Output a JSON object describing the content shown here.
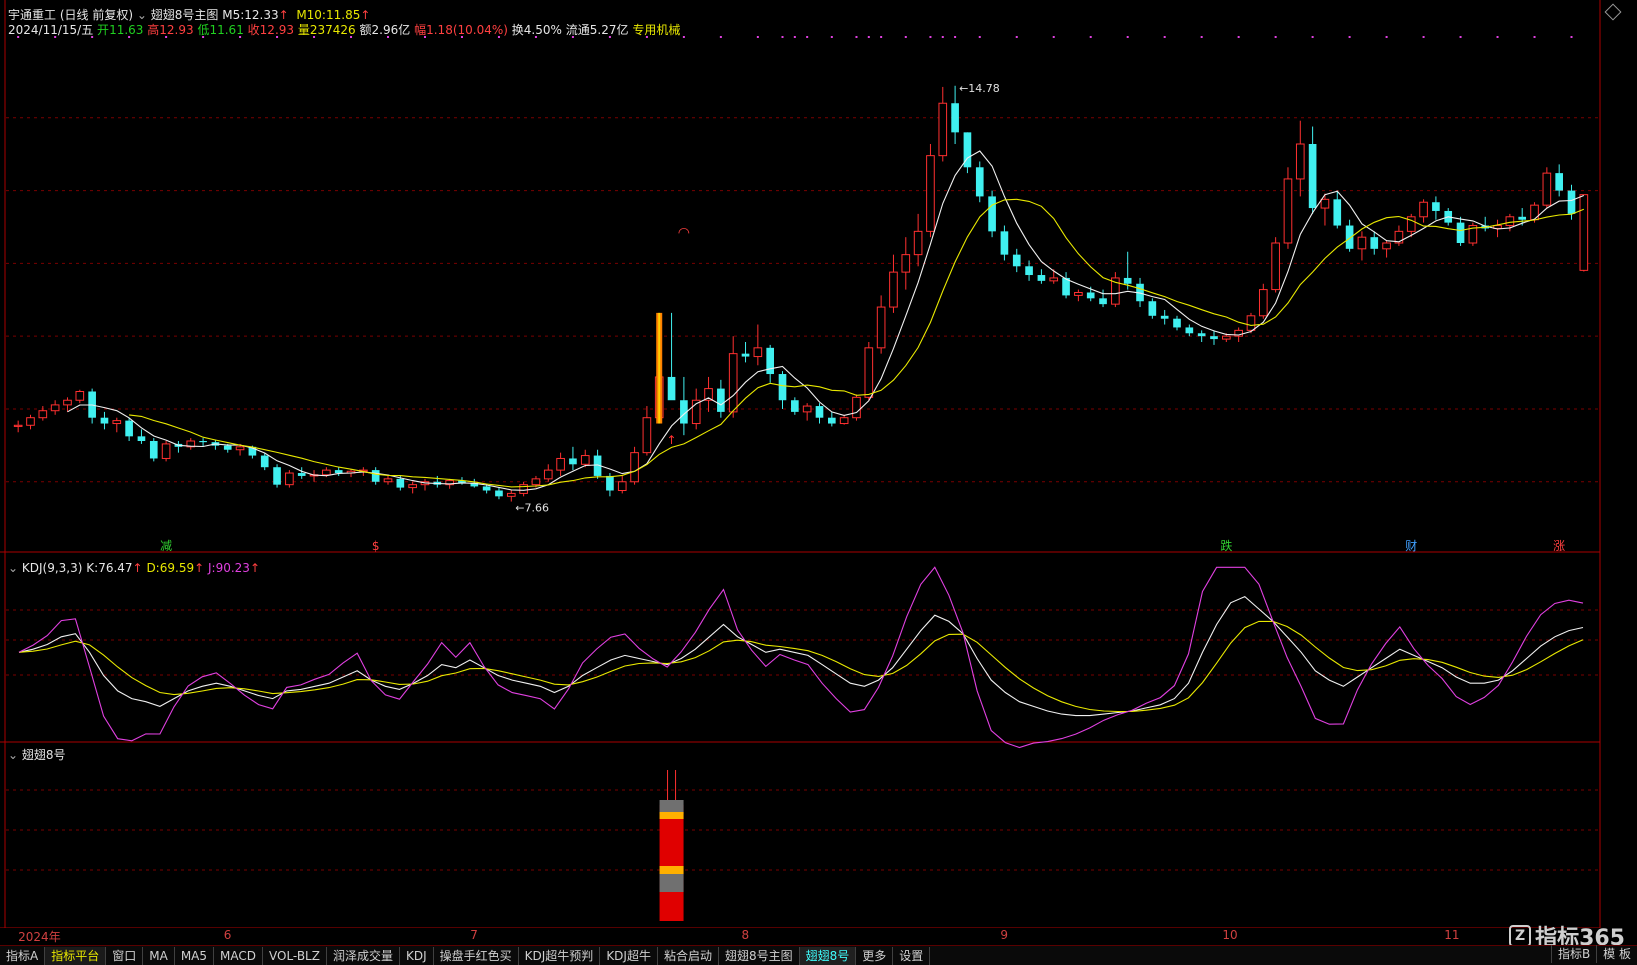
{
  "header": {
    "stock_name": "宇通重工",
    "period": "(日线 前复权)",
    "indicator": "翅翅8号主图",
    "ma5_label": "M5:",
    "ma5_value": "12.33",
    "ma10_label": "M10:",
    "ma10_value": "11.85",
    "date": "2024/11/15/五",
    "open_label": "开",
    "open": "11.63",
    "high_label": "高",
    "high": "12.93",
    "low_label": "低",
    "low": "11.61",
    "close_label": "收",
    "close": "12.93",
    "vol_label": "量",
    "vol": "237426",
    "amount_label": "额",
    "amount": "2.96亿",
    "change_label": "幅",
    "change": "1.18(10.04%)",
    "turnover_label": "换",
    "turnover": "4.50%",
    "float_label": "流通",
    "float": "5.27亿",
    "sector": "专用机械"
  },
  "kdj": {
    "title": "KDJ(9,3,3)",
    "k_label": "K:",
    "k": "76.47",
    "d_label": "D:",
    "d": "69.59",
    "j_label": "J:",
    "j": "90.23"
  },
  "sub2": {
    "title": "翅翅8号"
  },
  "time_axis": [
    {
      "label": "2024年",
      "i": 0
    },
    {
      "label": "6",
      "i": 17
    },
    {
      "label": "7",
      "i": 37
    },
    {
      "label": "8",
      "i": 59
    },
    {
      "label": "9",
      "i": 80
    },
    {
      "label": "10",
      "i": 98
    },
    {
      "label": "11",
      "i": 116
    }
  ],
  "markers": [
    {
      "label": "减",
      "i": 12,
      "color": "#30d030"
    },
    {
      "label": "$",
      "i": 29,
      "color": "#ff4040"
    },
    {
      "label": "跌",
      "i": 98,
      "color": "#30d030"
    },
    {
      "label": "财",
      "i": 113,
      "color": "#40a0ff"
    },
    {
      "label": "涨",
      "i": 125,
      "color": "#ff4040"
    }
  ],
  "annotations": {
    "high_label": "14.78",
    "low_label": "7.66"
  },
  "tabs": [
    "指标A",
    "指标平台",
    "窗口",
    "MA",
    "MA5",
    "MACD",
    "VOL-BLZ",
    "润泽成交量",
    "KDJ",
    "操盘手红色买",
    "KDJ超牛预判",
    "KDJ超牛",
    "粘合启动",
    "翅翅8号主图",
    "翅翅8号",
    "更多",
    "设置"
  ],
  "right_tabs": [
    "指标B",
    "模 板"
  ],
  "brand": "指标365",
  "colors": {
    "up": "#ff3030",
    "down": "#40f0f0",
    "ma5": "#f0f0f0",
    "ma10": "#e8e800",
    "k": "#f0f0f0",
    "d": "#e8e800",
    "j": "#e040e0",
    "grid": "#7a0000"
  },
  "chart_data": [
    {
      "type": "candlestick",
      "title": "宇通重工 (日线 前复权)",
      "ylim": [
        7.0,
        15.5
      ],
      "x_index": "trading day 0..126",
      "candles": [
        [
          8.95,
          9.05,
          8.85,
          8.97
        ],
        [
          8.97,
          9.15,
          8.9,
          9.1
        ],
        [
          9.1,
          9.3,
          9.05,
          9.22
        ],
        [
          9.22,
          9.4,
          9.15,
          9.32
        ],
        [
          9.32,
          9.45,
          9.2,
          9.4
        ],
        [
          9.4,
          9.58,
          9.35,
          9.55
        ],
        [
          9.55,
          9.6,
          9.0,
          9.1
        ],
        [
          9.1,
          9.2,
          8.9,
          9.0
        ],
        [
          9.0,
          9.1,
          8.85,
          9.05
        ],
        [
          9.05,
          9.1,
          8.7,
          8.78
        ],
        [
          8.78,
          8.9,
          8.65,
          8.7
        ],
        [
          8.7,
          8.75,
          8.35,
          8.4
        ],
        [
          8.4,
          8.7,
          8.35,
          8.65
        ],
        [
          8.65,
          8.7,
          8.5,
          8.6
        ],
        [
          8.6,
          8.75,
          8.55,
          8.7
        ],
        [
          8.7,
          8.75,
          8.6,
          8.68
        ],
        [
          8.68,
          8.72,
          8.55,
          8.62
        ],
        [
          8.62,
          8.65,
          8.5,
          8.55
        ],
        [
          8.55,
          8.65,
          8.45,
          8.6
        ],
        [
          8.6,
          8.62,
          8.4,
          8.45
        ],
        [
          8.45,
          8.5,
          8.2,
          8.25
        ],
        [
          8.25,
          8.3,
          7.9,
          7.95
        ],
        [
          7.95,
          8.2,
          7.9,
          8.15
        ],
        [
          8.15,
          8.25,
          8.05,
          8.1
        ],
        [
          8.1,
          8.2,
          8.0,
          8.12
        ],
        [
          8.12,
          8.25,
          8.08,
          8.2
        ],
        [
          8.2,
          8.25,
          8.1,
          8.15
        ],
        [
          8.15,
          8.22,
          8.08,
          8.18
        ],
        [
          8.18,
          8.25,
          8.1,
          8.2
        ],
        [
          8.2,
          8.25,
          7.95,
          8.0
        ],
        [
          8.0,
          8.1,
          7.95,
          8.05
        ],
        [
          8.05,
          8.1,
          7.85,
          7.9
        ],
        [
          7.9,
          8.0,
          7.8,
          7.95
        ],
        [
          7.95,
          8.05,
          7.85,
          8.0
        ],
        [
          8.0,
          8.1,
          7.9,
          7.95
        ],
        [
          7.95,
          8.05,
          7.88,
          8.02
        ],
        [
          8.02,
          8.08,
          7.95,
          7.98
        ],
        [
          7.98,
          8.05,
          7.9,
          7.92
        ],
        [
          7.92,
          7.95,
          7.8,
          7.85
        ],
        [
          7.85,
          7.9,
          7.7,
          7.75
        ],
        [
          7.75,
          7.85,
          7.66,
          7.8
        ],
        [
          7.8,
          8.0,
          7.75,
          7.95
        ],
        [
          7.95,
          8.1,
          7.9,
          8.05
        ],
        [
          8.05,
          8.3,
          8.0,
          8.2
        ],
        [
          8.2,
          8.5,
          8.1,
          8.4
        ],
        [
          8.4,
          8.6,
          8.2,
          8.3
        ],
        [
          8.3,
          8.55,
          8.25,
          8.45
        ],
        [
          8.45,
          8.55,
          8.05,
          8.1
        ],
        [
          8.1,
          8.15,
          7.75,
          7.85
        ],
        [
          7.85,
          8.1,
          7.8,
          8.0
        ],
        [
          8.0,
          8.6,
          7.95,
          8.5
        ],
        [
          8.5,
          9.3,
          8.45,
          9.1
        ],
        [
          9.1,
          10.1,
          9.05,
          9.8
        ],
        [
          9.8,
          10.9,
          9.5,
          9.4
        ],
        [
          9.4,
          9.8,
          8.8,
          9.0
        ],
        [
          9.0,
          9.6,
          8.9,
          9.4
        ],
        [
          9.4,
          9.8,
          9.2,
          9.6
        ],
        [
          9.6,
          9.75,
          9.1,
          9.2
        ],
        [
          9.2,
          10.5,
          9.1,
          10.2
        ],
        [
          10.2,
          10.4,
          10.05,
          10.15
        ],
        [
          10.15,
          10.7,
          10.0,
          10.3
        ],
        [
          10.3,
          10.35,
          9.7,
          9.85
        ],
        [
          9.85,
          9.9,
          9.25,
          9.4
        ],
        [
          9.4,
          9.45,
          9.15,
          9.2
        ],
        [
          9.2,
          9.35,
          9.05,
          9.3
        ],
        [
          9.3,
          9.35,
          9.0,
          9.1
        ],
        [
          9.1,
          9.2,
          8.95,
          9.0
        ],
        [
          9.0,
          9.15,
          8.98,
          9.1
        ],
        [
          9.1,
          9.5,
          9.05,
          9.45
        ],
        [
          9.45,
          10.4,
          9.4,
          10.3
        ],
        [
          10.3,
          11.2,
          10.2,
          11.0
        ],
        [
          11.0,
          11.9,
          10.9,
          11.6
        ],
        [
          11.6,
          12.2,
          11.3,
          11.9
        ],
        [
          11.9,
          12.6,
          11.7,
          12.3
        ],
        [
          12.3,
          13.8,
          12.2,
          13.6
        ],
        [
          13.6,
          14.78,
          13.5,
          14.5
        ],
        [
          14.5,
          14.8,
          13.8,
          14.0
        ],
        [
          14.0,
          14.0,
          13.3,
          13.4
        ],
        [
          13.4,
          13.5,
          12.8,
          12.9
        ],
        [
          12.9,
          13.0,
          12.2,
          12.3
        ],
        [
          12.3,
          12.4,
          11.8,
          11.9
        ],
        [
          11.9,
          12.0,
          11.6,
          11.7
        ],
        [
          11.7,
          11.8,
          11.45,
          11.55
        ],
        [
          11.55,
          11.65,
          11.4,
          11.45
        ],
        [
          11.45,
          11.65,
          11.4,
          11.5
        ],
        [
          11.5,
          11.6,
          11.15,
          11.2
        ],
        [
          11.2,
          11.3,
          11.1,
          11.25
        ],
        [
          11.25,
          11.35,
          11.1,
          11.15
        ],
        [
          11.15,
          11.3,
          11.0,
          11.05
        ],
        [
          11.05,
          11.6,
          11.0,
          11.5
        ],
        [
          11.5,
          11.95,
          11.3,
          11.4
        ],
        [
          11.4,
          11.5,
          11.0,
          11.1
        ],
        [
          11.1,
          11.15,
          10.8,
          10.85
        ],
        [
          10.85,
          10.95,
          10.7,
          10.8
        ],
        [
          10.8,
          10.85,
          10.6,
          10.65
        ],
        [
          10.65,
          10.7,
          10.5,
          10.55
        ],
        [
          10.55,
          10.6,
          10.4,
          10.5
        ],
        [
          10.5,
          10.6,
          10.35,
          10.45
        ],
        [
          10.45,
          10.55,
          10.4,
          10.5
        ],
        [
          10.5,
          10.65,
          10.4,
          10.6
        ],
        [
          10.6,
          10.9,
          10.55,
          10.85
        ],
        [
          10.85,
          11.4,
          10.8,
          11.3
        ],
        [
          11.3,
          12.2,
          11.25,
          12.1
        ],
        [
          12.1,
          13.4,
          12.0,
          13.2
        ],
        [
          13.2,
          14.2,
          12.9,
          13.8
        ],
        [
          13.8,
          14.1,
          12.6,
          12.7
        ],
        [
          12.7,
          12.95,
          12.4,
          12.85
        ],
        [
          12.85,
          13.0,
          12.35,
          12.4
        ],
        [
          12.4,
          12.5,
          11.95,
          12.0
        ],
        [
          12.0,
          12.3,
          11.8,
          12.2
        ],
        [
          12.2,
          12.3,
          11.9,
          12.0
        ],
        [
          12.0,
          12.15,
          11.85,
          12.1
        ],
        [
          12.1,
          12.4,
          12.05,
          12.3
        ],
        [
          12.3,
          12.6,
          12.2,
          12.55
        ],
        [
          12.55,
          12.85,
          12.45,
          12.8
        ],
        [
          12.8,
          12.9,
          12.5,
          12.65
        ],
        [
          12.65,
          12.7,
          12.4,
          12.45
        ],
        [
          12.45,
          12.55,
          12.05,
          12.1
        ],
        [
          12.1,
          12.45,
          12.05,
          12.4
        ],
        [
          12.4,
          12.55,
          12.3,
          12.35
        ],
        [
          12.35,
          12.5,
          12.2,
          12.4
        ],
        [
          12.4,
          12.6,
          12.3,
          12.55
        ],
        [
          12.55,
          12.7,
          12.4,
          12.5
        ],
        [
          12.5,
          12.8,
          12.45,
          12.75
        ],
        [
          12.75,
          13.4,
          12.7,
          13.3
        ],
        [
          13.3,
          13.45,
          12.9,
          13.0
        ],
        [
          13.0,
          13.1,
          12.5,
          12.6
        ],
        [
          11.63,
          12.93,
          11.61,
          12.93
        ]
      ]
    },
    {
      "type": "line",
      "title": "KDJ(9,3,3)",
      "ylim": [
        0,
        110
      ],
      "series": [
        {
          "name": "K",
          "values": [
            60,
            62,
            65,
            70,
            72,
            60,
            45,
            35,
            30,
            28,
            25,
            30,
            35,
            38,
            40,
            38,
            35,
            32,
            30,
            35,
            36,
            38,
            40,
            44,
            48,
            42,
            38,
            36,
            40,
            45,
            52,
            50,
            55,
            50,
            45,
            42,
            40,
            38,
            34,
            38,
            45,
            50,
            55,
            58,
            56,
            54,
            52,
            56,
            62,
            70,
            78,
            70,
            65,
            60,
            62,
            60,
            58,
            52,
            46,
            40,
            38,
            42,
            50,
            62,
            74,
            84,
            80,
            72,
            56,
            42,
            34,
            28,
            25,
            22,
            20,
            19,
            19,
            20,
            21,
            22,
            24,
            26,
            30,
            40,
            60,
            78,
            92,
            96,
            88,
            80,
            70,
            60,
            48,
            42,
            38,
            44,
            50,
            56,
            62,
            58,
            54,
            50,
            44,
            40,
            40,
            42,
            48,
            56,
            64,
            70,
            74,
            76
          ]
        }
      ]
    }
  ]
}
